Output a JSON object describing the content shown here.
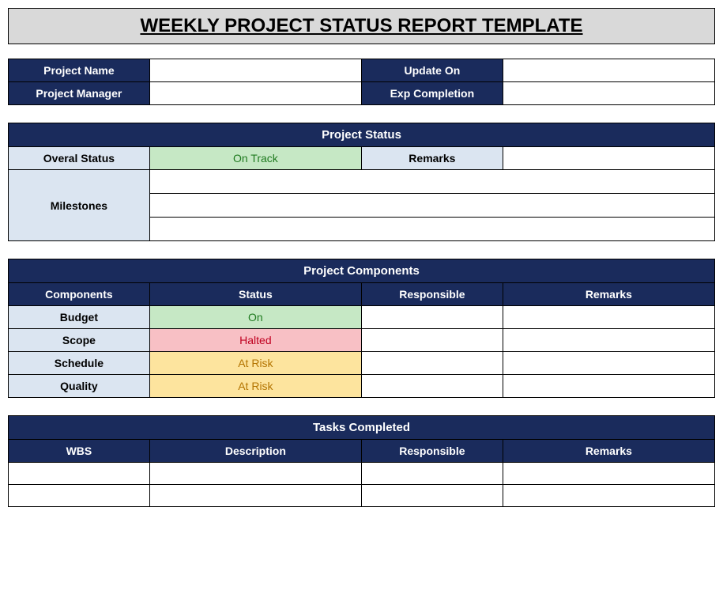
{
  "title": "WEEKLY PROJECT STATUS REPORT TEMPLATE",
  "info": {
    "project_name_label": "Project Name",
    "project_name_value": "",
    "update_on_label": "Update On",
    "update_on_value": "",
    "project_manager_label": "Project Manager",
    "project_manager_value": "",
    "exp_completion_label": "Exp Completion",
    "exp_completion_value": ""
  },
  "project_status": {
    "header": "Project Status",
    "overall_status_label": "Overal Status",
    "overall_status_value": "On Track",
    "remarks_label": "Remarks",
    "remarks_value": "",
    "milestones_label": "Milestones",
    "milestone_rows": [
      "",
      "",
      ""
    ]
  },
  "project_components": {
    "header": "Project Components",
    "columns": {
      "components": "Components",
      "status": "Status",
      "responsible": "Responsible",
      "remarks": "Remarks"
    },
    "rows": [
      {
        "component": "Budget",
        "status": "On",
        "status_class": "green-cell",
        "responsible": "",
        "remarks": ""
      },
      {
        "component": "Scope",
        "status": "Halted",
        "status_class": "pink-cell",
        "responsible": "",
        "remarks": ""
      },
      {
        "component": "Schedule",
        "status": "At Risk",
        "status_class": "yellow-cell",
        "responsible": "",
        "remarks": ""
      },
      {
        "component": "Quality",
        "status": "At Risk",
        "status_class": "yellow-cell",
        "responsible": "",
        "remarks": ""
      }
    ]
  },
  "tasks_completed": {
    "header": "Tasks Completed",
    "columns": {
      "wbs": "WBS",
      "description": "Description",
      "responsible": "Responsible",
      "remarks": "Remarks"
    },
    "rows": [
      {
        "wbs": "",
        "description": "",
        "responsible": "",
        "remarks": ""
      },
      {
        "wbs": "",
        "description": "",
        "responsible": "",
        "remarks": ""
      }
    ]
  }
}
